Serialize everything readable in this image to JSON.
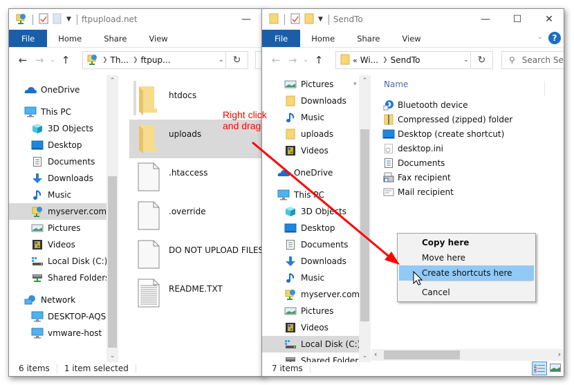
{
  "left_window": {
    "title": "ftpupload.net",
    "ribbon_tabs": [
      "File",
      "Home",
      "Share",
      "View"
    ],
    "address": {
      "crumbs": [
        "Th...",
        "ftpup..."
      ]
    },
    "nav_pane": {
      "items": [
        {
          "label": "OneDrive",
          "icon": "onedrive-icon",
          "level": 0
        },
        {
          "label": "This PC",
          "icon": "this-pc-icon",
          "level": 0
        },
        {
          "label": "3D Objects",
          "icon": "3d-objects-icon",
          "level": 1
        },
        {
          "label": "Desktop",
          "icon": "desktop-icon",
          "level": 1
        },
        {
          "label": "Documents",
          "icon": "documents-icon",
          "level": 1
        },
        {
          "label": "Downloads",
          "icon": "downloads-icon",
          "level": 1
        },
        {
          "label": "Music",
          "icon": "music-icon",
          "level": 1
        },
        {
          "label": "myserver.com",
          "icon": "network-location-icon",
          "level": 1,
          "selected": true
        },
        {
          "label": "Pictures",
          "icon": "pictures-icon",
          "level": 1
        },
        {
          "label": "Videos",
          "icon": "videos-icon",
          "level": 1
        },
        {
          "label": "Local Disk (C:)",
          "icon": "local-disk-icon",
          "level": 1
        },
        {
          "label": "Shared Folders (\\",
          "icon": "shared-folders-icon",
          "level": 1
        },
        {
          "label": "Network",
          "icon": "network-icon",
          "level": 0
        },
        {
          "label": "DESKTOP-AQSFJ",
          "icon": "computer-icon",
          "level": 1
        },
        {
          "label": "vmware-host",
          "icon": "computer-icon",
          "level": 1
        }
      ]
    },
    "files": [
      {
        "name": "htdocs",
        "type": "folder"
      },
      {
        "name": "uploads",
        "type": "folder",
        "selected": true
      },
      {
        "name": ".htaccess",
        "type": "file"
      },
      {
        "name": ".override",
        "type": "file"
      },
      {
        "name": "DO NOT UPLOAD FILES H",
        "type": "file"
      },
      {
        "name": "README.TXT",
        "type": "text"
      }
    ],
    "status": {
      "items": "6 items",
      "selected": "1 item selected"
    }
  },
  "right_window": {
    "title": "SendTo",
    "ribbon_tabs": [
      "File",
      "Home",
      "Share",
      "View"
    ],
    "address": {
      "prefix": "«",
      "crumbs": [
        "Wi...",
        "SendTo"
      ]
    },
    "search_placeholder": "Search Ser",
    "nav_pane": {
      "items": [
        {
          "label": "Pictures",
          "icon": "pictures-icon",
          "level": 1,
          "pinned": true
        },
        {
          "label": "Downloads",
          "icon": "folder-icon",
          "level": 1
        },
        {
          "label": "Music",
          "icon": "music-icon",
          "level": 1
        },
        {
          "label": "uploads",
          "icon": "folder-icon",
          "level": 1
        },
        {
          "label": "Videos",
          "icon": "videos-icon",
          "level": 1
        },
        {
          "label": "OneDrive",
          "icon": "onedrive-icon",
          "level": 0
        },
        {
          "label": "This PC",
          "icon": "this-pc-icon",
          "level": 0
        },
        {
          "label": "3D Objects",
          "icon": "3d-objects-icon",
          "level": 1
        },
        {
          "label": "Desktop",
          "icon": "desktop-icon",
          "level": 1
        },
        {
          "label": "Documents",
          "icon": "documents-icon",
          "level": 1
        },
        {
          "label": "Downloads",
          "icon": "downloads-icon",
          "level": 1
        },
        {
          "label": "Music",
          "icon": "music-icon",
          "level": 1
        },
        {
          "label": "myserver.com",
          "icon": "network-location-icon",
          "level": 1
        },
        {
          "label": "Pictures",
          "icon": "pictures-icon",
          "level": 1
        },
        {
          "label": "Videos",
          "icon": "videos-icon",
          "level": 1
        },
        {
          "label": "Local Disk (C:)",
          "icon": "local-disk-icon",
          "level": 1,
          "selected": true
        },
        {
          "label": "Shared Folders (\\",
          "icon": "shared-folders-icon",
          "level": 1
        }
      ]
    },
    "column_header": "Name",
    "files": [
      {
        "name": "Bluetooth device",
        "icon": "bluetooth-icon"
      },
      {
        "name": "Compressed (zipped) folder",
        "icon": "zip-folder-icon"
      },
      {
        "name": "Desktop (create shortcut)",
        "icon": "desktop-icon"
      },
      {
        "name": "desktop.ini",
        "icon": "ini-file-icon"
      },
      {
        "name": "Documents",
        "icon": "documents-icon"
      },
      {
        "name": "Fax recipient",
        "icon": "fax-icon"
      },
      {
        "name": "Mail recipient",
        "icon": "mail-icon"
      }
    ],
    "status": {
      "items": "7 items"
    }
  },
  "context_menu": {
    "items": [
      {
        "label": "Copy here",
        "bold": true
      },
      {
        "label": "Move here"
      },
      {
        "label": "Create shortcuts here",
        "highlighted": true
      },
      {
        "label": "Cancel"
      }
    ]
  },
  "annotation": {
    "line1": "Right click",
    "line2": "and drag",
    "color": "#ff0000"
  },
  "colors": {
    "file_tab": "#1a5ea8",
    "selection": "#d9d9d9",
    "menu_highlight": "#91c9f7"
  }
}
